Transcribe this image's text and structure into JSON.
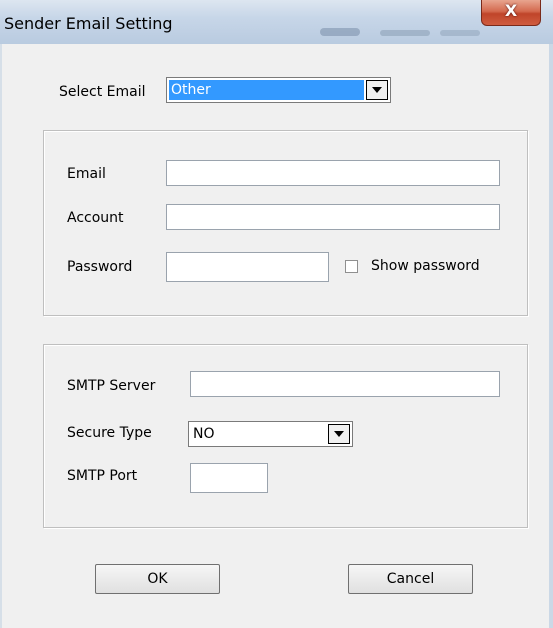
{
  "window": {
    "title": "Sender Email Setting",
    "close_glyph": "X"
  },
  "select_email": {
    "label": "Select Email",
    "value": "Other"
  },
  "account_group": {
    "email_label": "Email",
    "email_value": "",
    "account_label": "Account",
    "account_value": "",
    "password_label": "Password",
    "password_value": "",
    "show_password_label": "Show password",
    "show_password_checked": false
  },
  "smtp_group": {
    "server_label": "SMTP Server",
    "server_value": "",
    "secure_type_label": "Secure Type",
    "secure_type_value": "NO",
    "port_label": "SMTP Port",
    "port_value": ""
  },
  "buttons": {
    "ok_label": "OK",
    "cancel_label": "Cancel"
  },
  "icons": {
    "close": "close-icon",
    "dropdown": "chevron-down-icon"
  }
}
